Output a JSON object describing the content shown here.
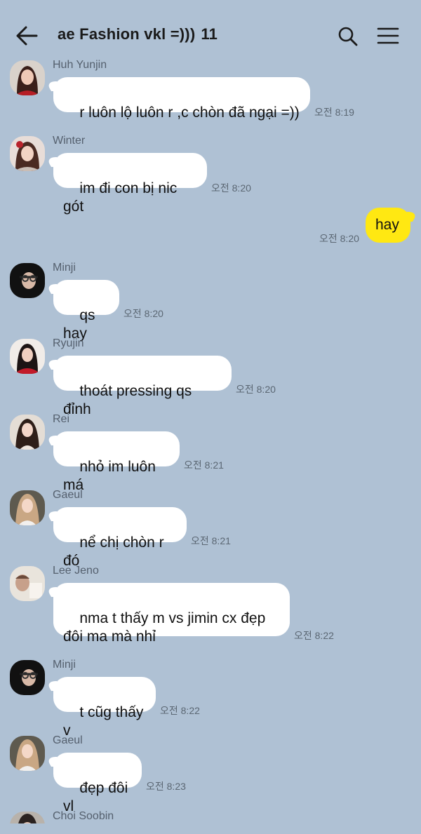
{
  "header": {
    "title": "ae Fashion vkl =)))",
    "member_count": "11"
  },
  "messages": [
    {
      "sender": "Huh Yunjin",
      "text": "r luôn lộ luôn r ,c chòn đã ngại =))",
      "time": "오전 8:19",
      "avatar": "avatar-huh-yunjin"
    },
    {
      "sender": "Winter",
      "text": "im đi con bị nic gót",
      "time": "오전 8:20",
      "avatar": "avatar-winter"
    },
    {
      "mine": true,
      "text": "hay",
      "time": "오전 8:20"
    },
    {
      "sender": "Minji",
      "text": "qs hay",
      "time": "오전 8:20",
      "avatar": "avatar-minji"
    },
    {
      "sender": "Ryujin",
      "text": "thoát pressing qs đỉnh",
      "time": "오전 8:20",
      "avatar": "avatar-ryujin"
    },
    {
      "sender": "Rei",
      "text": "nhỏ im luôn má",
      "time": "오전 8:21",
      "avatar": "avatar-rei"
    },
    {
      "sender": "Gaeul",
      "text": "nể chị chòn r đó",
      "time": "오전 8:21",
      "avatar": "avatar-gaeul"
    },
    {
      "sender": "Lee Jeno",
      "text": "nma t thấy m vs jimin cx đẹp\nđôi ma mà nhỉ",
      "time": "오전 8:22",
      "avatar": "avatar-lee-jeno"
    },
    {
      "sender": "Minji",
      "text": "t cũg thấy v",
      "time": "오전 8:22",
      "avatar": "avatar-minji"
    },
    {
      "sender": "Gaeul",
      "text": "đẹp đôi vl",
      "time": "오전 8:23",
      "avatar": "avatar-gaeul"
    },
    {
      "sender": "Choi Soobin",
      "avatar": "avatar-choi-soobin"
    }
  ],
  "colors": {
    "background": "#AFC1D4",
    "my_bubble": "#FFE812",
    "other_bubble": "#FFFFFF"
  },
  "icons": {
    "back": "arrow-left-icon",
    "search": "search-icon",
    "menu": "hamburger-menu-icon"
  }
}
